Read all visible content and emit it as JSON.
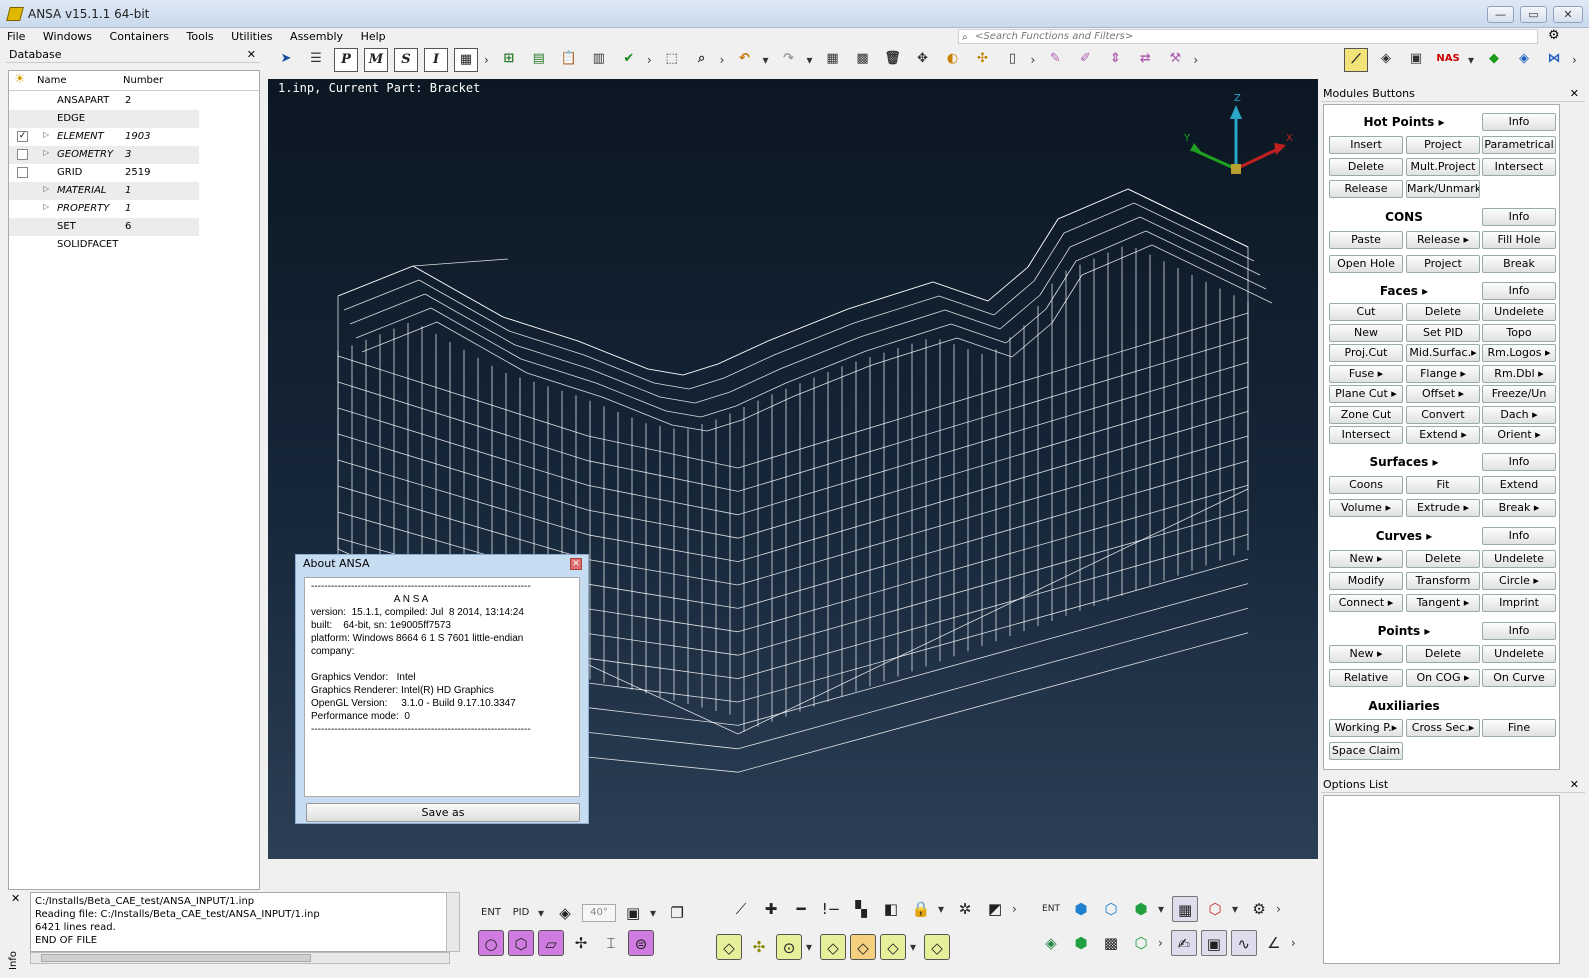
{
  "window": {
    "title": "ANSA v15.1.1 64-bit",
    "min": "—",
    "max": "▭",
    "close": "✕"
  },
  "menu": [
    "File",
    "Windows",
    "Containers",
    "Tools",
    "Utilities",
    "Assembly",
    "Help"
  ],
  "search": {
    "placeholder": "<Search Functions and Filters>"
  },
  "database": {
    "title": "Database",
    "col_name": "Name",
    "col_number": "Number",
    "rows": [
      {
        "name": "ANSAPART",
        "number": "2",
        "checkbox": false,
        "checked": false,
        "expand": false,
        "italic": false
      },
      {
        "name": "EDGE",
        "number": "",
        "checkbox": false,
        "checked": false,
        "expand": false,
        "italic": false
      },
      {
        "name": "ELEMENT",
        "number": "1903",
        "checkbox": true,
        "checked": true,
        "expand": true,
        "italic": true
      },
      {
        "name": "GEOMETRY",
        "number": "3",
        "checkbox": true,
        "checked": false,
        "expand": true,
        "italic": true
      },
      {
        "name": "GRID",
        "number": "2519",
        "checkbox": true,
        "checked": false,
        "expand": false,
        "italic": false
      },
      {
        "name": "MATERIAL",
        "number": "1",
        "checkbox": false,
        "checked": false,
        "expand": true,
        "italic": true
      },
      {
        "name": "PROPERTY",
        "number": "1",
        "checkbox": false,
        "checked": false,
        "expand": true,
        "italic": true
      },
      {
        "name": "SET",
        "number": "6",
        "checkbox": false,
        "checked": false,
        "expand": false,
        "italic": false
      },
      {
        "name": "SOLIDFACET",
        "number": "",
        "checkbox": false,
        "checked": false,
        "expand": false,
        "italic": false
      }
    ]
  },
  "viewport": {
    "label": "1.inp,  Current Part: Bracket",
    "axis_x": "X",
    "axis_y": "Y",
    "axis_z": "Z"
  },
  "toolbar_top": [
    "P",
    "M",
    "S",
    "I"
  ],
  "modules": {
    "title": "Modules Buttons",
    "hotpoints": {
      "title": "Hot Points ▸",
      "info": "Info",
      "b1": "Insert",
      "b2": "Project",
      "b3": "Parametrical",
      "b4": "Delete",
      "b5": "Mult.Project",
      "b6": "Intersect",
      "b7": "Release",
      "b8": "Mark/Unmark"
    },
    "cons": {
      "title": "CONS",
      "info": "Info",
      "b1": "Paste",
      "b2": "Release ▸",
      "b3": "Fill Hole",
      "b4": "Open Hole",
      "b5": "Project",
      "b6": "Break"
    },
    "faces": {
      "title": "Faces ▸",
      "info": "Info",
      "b1": "Cut",
      "b2": "Delete",
      "b3": "Undelete",
      "b4": "New",
      "b5": "Set PID",
      "b6": "Topo",
      "b7": "Proj.Cut",
      "b8": "Mid.Surfac.▸",
      "b9": "Rm.Logos ▸",
      "b10": "Fuse ▸",
      "b11": "Flange ▸",
      "b12": "Rm.Dbl ▸",
      "b13": "Plane Cut ▸",
      "b14": "Offset ▸",
      "b15": "Freeze/Un",
      "b16": "Zone Cut",
      "b17": "Convert",
      "b18": "Dach ▸",
      "b19": "Intersect",
      "b20": "Extend ▸",
      "b21": "Orient ▸"
    },
    "surfaces": {
      "title": "Surfaces ▸",
      "info": "Info",
      "b1": "Coons",
      "b2": "Fit",
      "b3": "Extend",
      "b4": "Volume ▸",
      "b5": "Extrude ▸",
      "b6": "Break ▸"
    },
    "curves": {
      "title": "Curves ▸",
      "info": "Info",
      "b1": "New ▸",
      "b2": "Delete",
      "b3": "Undelete",
      "b4": "Modify",
      "b5": "Transform",
      "b6": "Circle ▸",
      "b7": "Connect ▸",
      "b8": "Tangent ▸",
      "b9": "Imprint"
    },
    "points": {
      "title": "Points ▸",
      "info": "Info",
      "b1": "New ▸",
      "b2": "Delete",
      "b3": "Undelete",
      "b4": "Relative",
      "b5": "On COG ▸",
      "b6": "On Curve"
    },
    "aux": {
      "title": "Auxiliaries",
      "b1": "Working P.▸",
      "b2": "Cross Sec.▸",
      "b3": "Fine",
      "b4": "Space Claim"
    }
  },
  "options": {
    "title": "Options List"
  },
  "about": {
    "title": "About ANSA",
    "line0": "------------------------------------------------------------------",
    "line1": "                              A N S A",
    "line2": "version:  15.1.1, compiled: Jul  8 2014, 13:14:24",
    "line3": "built:    64-bit, sn: 1e9005ff7573",
    "line4": "platform: Windows 8664 6 1 S 7601 little-endian",
    "line5": "company:",
    "line6": "",
    "line7": "Graphics Vendor:   Intel",
    "line8": "Graphics Renderer: Intel(R) HD Graphics",
    "line9": "OpenGL Version:     3.1.0 - Build 9.17.10.3347",
    "line10": "Performance mode:  0",
    "line11": "------------------------------------------------------------------",
    "save": "Save as"
  },
  "console": {
    "label": "Info",
    "lines": "C:/Installs/Beta_CAE_test/ANSA_INPUT/1.inp\nReading file: C:/Installs/Beta_CAE_test/ANSA_INPUT/1.inp\n6421 lines read.\nEND OF FILE"
  },
  "bottom": {
    "ent": "ENT",
    "pid": "PID",
    "angle": "40°",
    "ent2": "ENT"
  },
  "nas_label": "NAS"
}
